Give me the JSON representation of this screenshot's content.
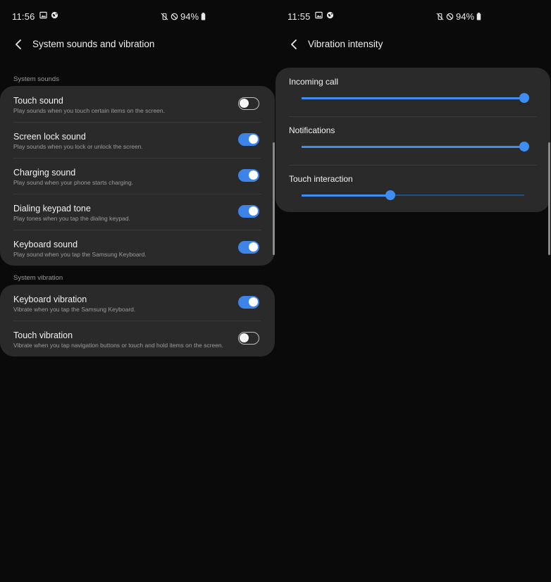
{
  "left_screen": {
    "status": {
      "time": "11:56",
      "battery": "94%"
    },
    "header": {
      "title": "System sounds and vibration"
    },
    "sections": [
      {
        "label": "System sounds",
        "items": [
          {
            "title": "Touch sound",
            "subtitle": "Play sounds when you touch certain items on the screen.",
            "enabled": false
          },
          {
            "title": "Screen lock sound",
            "subtitle": "Play sounds when you lock or unlock the screen.",
            "enabled": true
          },
          {
            "title": "Charging sound",
            "subtitle": "Play sound when your phone starts charging.",
            "enabled": true
          },
          {
            "title": "Dialing keypad tone",
            "subtitle": "Play tones when you tap the dialing keypad.",
            "enabled": true
          },
          {
            "title": "Keyboard sound",
            "subtitle": "Play sound when you tap the Samsung Keyboard.",
            "enabled": true
          }
        ]
      },
      {
        "label": "System vibration",
        "items": [
          {
            "title": "Keyboard vibration",
            "subtitle": "Vibrate when you tap the Samsung Keyboard.",
            "enabled": true
          },
          {
            "title": "Touch vibration",
            "subtitle": "Vibrate when you tap navigation buttons or touch and hold items on the screen.",
            "enabled": false
          }
        ]
      }
    ]
  },
  "right_screen": {
    "status": {
      "time": "11:55",
      "battery": "94%"
    },
    "header": {
      "title": "Vibration intensity"
    },
    "sliders": [
      {
        "label": "Incoming call",
        "level": 1.0
      },
      {
        "label": "Notifications",
        "level": 1.0
      },
      {
        "label": "Touch interaction",
        "level": 0.4
      }
    ]
  },
  "colors": {
    "background": "#0a0a0a",
    "card": "#2a2a2a",
    "accent": "#3d83e8",
    "divider": "#3a3a3a",
    "secondary_text": "#9c9c9c"
  },
  "icons": {
    "back": "chevron-left-icon",
    "gallery": "image-icon",
    "status_app": "globe-icon",
    "mute": "vibrate-mute-icon",
    "dnd": "do-not-disturb-icon",
    "battery": "battery-icon"
  }
}
